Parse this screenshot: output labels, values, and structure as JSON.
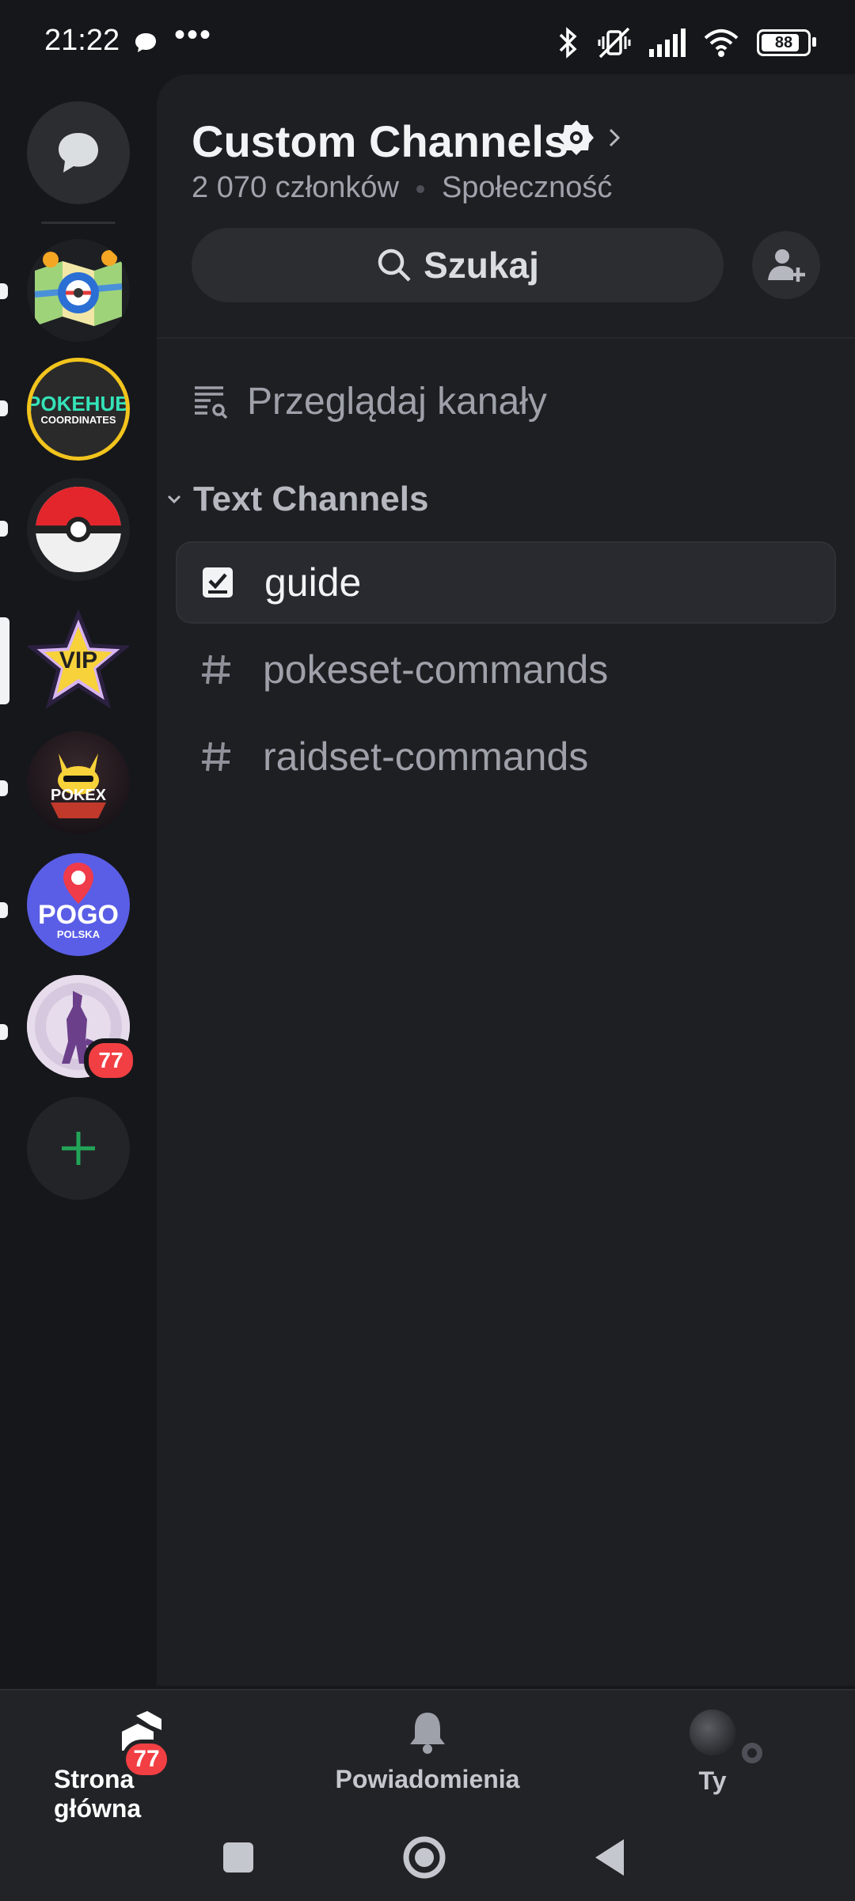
{
  "status_bar": {
    "time": "21:22",
    "dots": "•••",
    "battery": "88",
    "icons": [
      "chat-bubble-icon",
      "bluetooth-icon",
      "vibrate-off-icon",
      "signal-icon",
      "wifi-icon",
      "battery-icon"
    ]
  },
  "server_rail": {
    "servers": [
      {
        "name": "map-server",
        "colors": [
          "#4a90d9",
          "#f5c242"
        ]
      },
      {
        "name": "pokehub-coordinates",
        "text": "POKEHUB",
        "subtext": "COORDINATES"
      },
      {
        "name": "pokeball-server"
      },
      {
        "name": "vip-server",
        "text": "VIP"
      },
      {
        "name": "pokex-server",
        "text": "POKEX"
      },
      {
        "name": "pogo-polska",
        "text": "POGO",
        "subtext": "POLSKA"
      },
      {
        "name": "mewtwo-server",
        "badge": "77"
      }
    ]
  },
  "header": {
    "title": "Custom Channels",
    "members": "2 070 członków",
    "type": "Społeczność",
    "search_label": "Szukaj"
  },
  "browse": {
    "label": "Przeglądaj kanały"
  },
  "category": {
    "label": "Text Channels"
  },
  "channels": [
    {
      "label": "guide",
      "icon": "checklist-icon",
      "active": true
    },
    {
      "label": "pokeset-commands",
      "icon": "hash-icon"
    },
    {
      "label": "raidset-commands",
      "icon": "hash-icon"
    }
  ],
  "bottom_nav": {
    "home": {
      "label": "Strona główna",
      "badge": "77"
    },
    "notifications": {
      "label": "Powiadomienia"
    },
    "you": {
      "label": "Ty"
    }
  },
  "colors": {
    "accent": "#23a559",
    "badge": "#f23f43",
    "background": "#1e1f23"
  }
}
